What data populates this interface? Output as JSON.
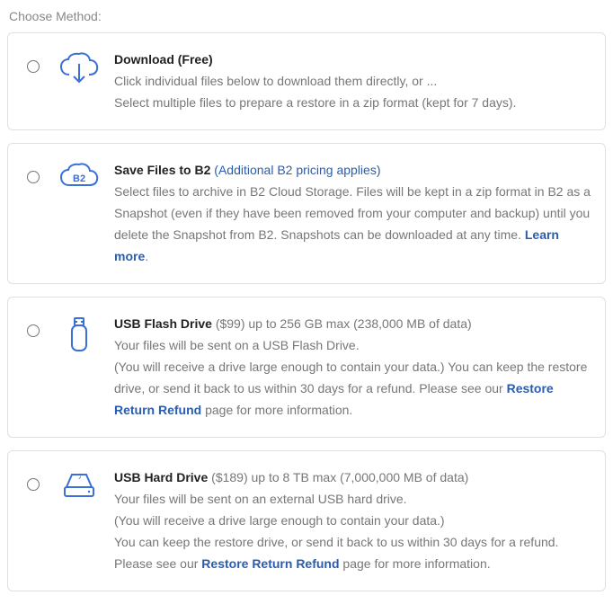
{
  "header": {
    "label": "Choose Method:"
  },
  "options": {
    "download": {
      "title": "Download (Free)",
      "line1": "Click individual files below to download them directly, or ...",
      "line2": "Select multiple files to prepare a restore in a zip format (kept for 7 days)."
    },
    "b2": {
      "title": "Save Files to B2",
      "title_extra": " (Additional B2 pricing applies)",
      "desc": "Select files to archive in B2 Cloud Storage. Files will be kept in a zip format in B2 as a Snapshot (even if they have been removed from your computer and backup) until you delete the Snapshot from B2. Snapshots can be downloaded at any time. ",
      "learn_more": "Learn more",
      "period": "."
    },
    "usb_flash": {
      "title": "USB Flash Drive",
      "title_extra": " ($99) up to 256 GB max (238,000 MB of data)",
      "line1": "Your files will be sent on a USB Flash Drive.",
      "line2": "(You will receive a drive large enough to contain your data.) You can keep the restore drive, or send it back to us within 30 days for a refund. Please see our ",
      "link": "Restore Return Refund",
      "line3": " page for more information."
    },
    "usb_hard": {
      "title": "USB Hard Drive",
      "title_extra": " ($189) up to 8 TB max (7,000,000 MB of data)",
      "line1": "Your files will be sent on an external USB hard drive.",
      "line2": "(You will receive a drive large enough to contain your data.)",
      "line3": "You can keep the restore drive, or send it back to us within 30 days for a refund. Please see our ",
      "link": "Restore Return Refund",
      "line4": " page for more information."
    }
  }
}
